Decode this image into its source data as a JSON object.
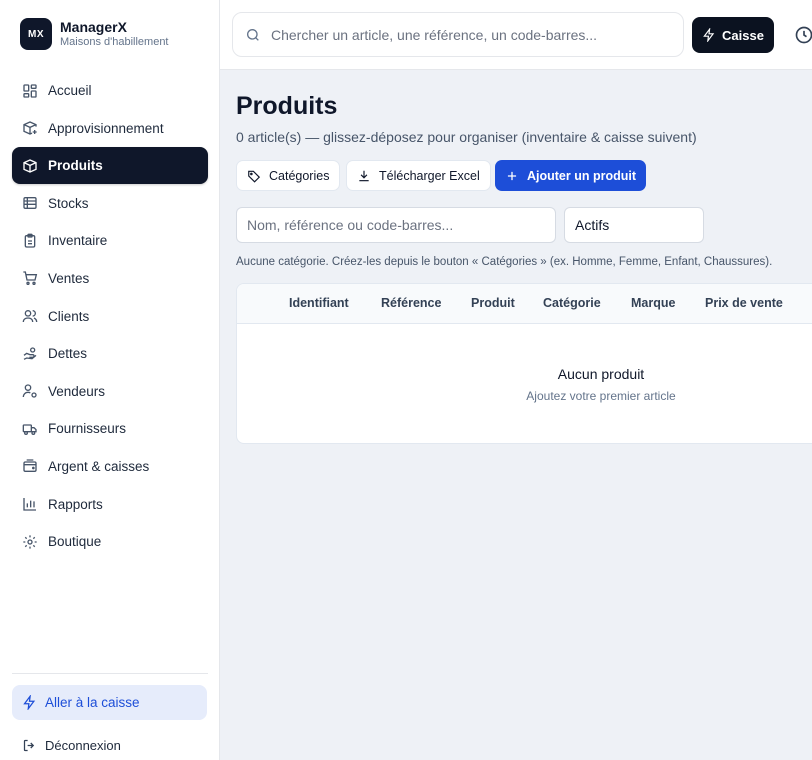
{
  "brand": {
    "logo": "MX",
    "name": "ManagerX",
    "subtitle": "Maisons d'habillement"
  },
  "sidebar": {
    "items": [
      {
        "label": "Accueil",
        "icon": "dashboard-icon"
      },
      {
        "label": "Approvisionnement",
        "icon": "box-plus-icon"
      },
      {
        "label": "Produits",
        "icon": "package-icon",
        "active": true
      },
      {
        "label": "Stocks",
        "icon": "database-icon"
      },
      {
        "label": "Inventaire",
        "icon": "clipboard-icon"
      },
      {
        "label": "Ventes",
        "icon": "cart-icon"
      },
      {
        "label": "Clients",
        "icon": "users-icon"
      },
      {
        "label": "Dettes",
        "icon": "hand-coins-icon"
      },
      {
        "label": "Vendeurs",
        "icon": "user-cog-icon"
      },
      {
        "label": "Fournisseurs",
        "icon": "truck-icon"
      },
      {
        "label": "Argent & caisses",
        "icon": "wallet-icon"
      },
      {
        "label": "Rapports",
        "icon": "bar-chart-icon"
      },
      {
        "label": "Boutique",
        "icon": "gear-icon"
      }
    ],
    "cash_link": "Aller à la caisse",
    "logout": "Déconnexion"
  },
  "topbar": {
    "search_placeholder": "Chercher un article, une référence, un code-barres...",
    "caisse_label": "Caisse"
  },
  "main": {
    "title": "Produits",
    "subtitle": "0 article(s) — glissez-déposez pour organiser (inventaire & caisse suivent)",
    "buttons": {
      "categories": "Catégories",
      "excel": "Télécharger Excel",
      "add": "Ajouter un produit"
    },
    "filter_placeholder": "Nom, référence ou code-barres...",
    "status_value": "Actifs",
    "hint": "Aucune catégorie. Créez-les depuis le bouton « Catégories » (ex. Homme, Femme, Enfant, Chaussures).",
    "table": {
      "columns": [
        "Identifiant",
        "Référence",
        "Produit",
        "Catégorie",
        "Marque",
        "Prix de vente"
      ],
      "rows": [],
      "empty_title": "Aucun produit",
      "empty_sub": "Ajoutez votre premier article"
    }
  },
  "colors": {
    "accent": "#1d4ed8",
    "dark": "#0f172a",
    "background": "#eef1f6"
  }
}
